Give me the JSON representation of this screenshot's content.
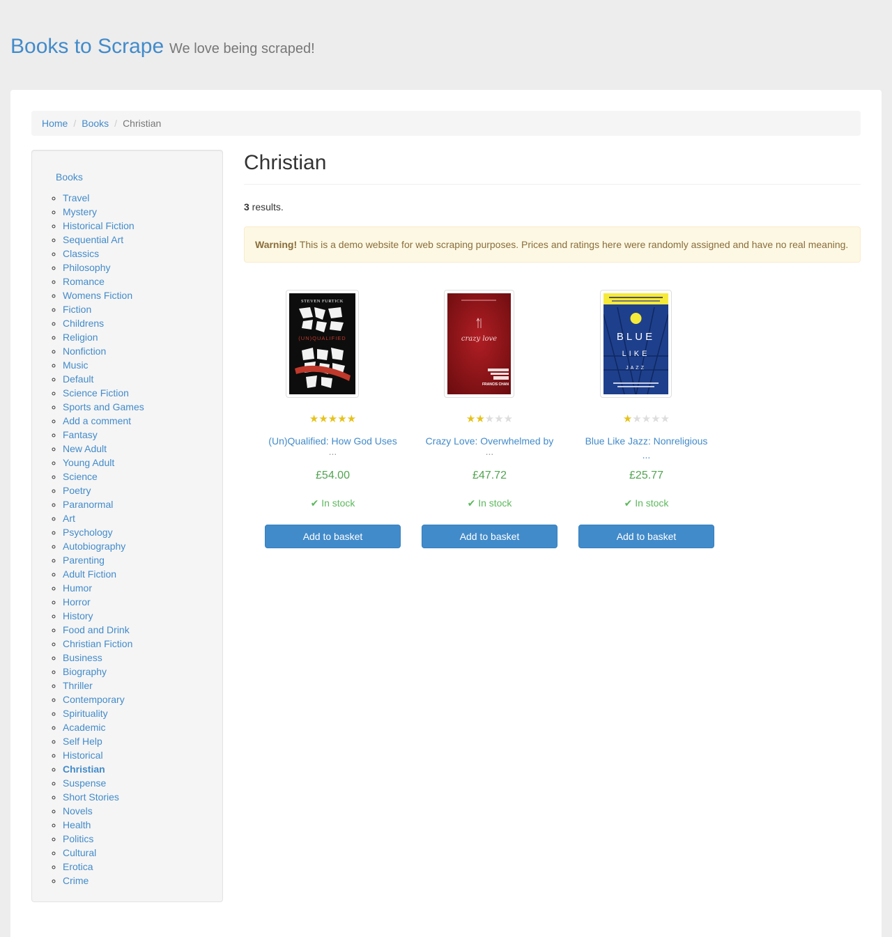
{
  "header": {
    "brand": "Books to Scrape",
    "tagline": "We love being scraped!"
  },
  "breadcrumb": {
    "items": [
      "Home",
      "Books",
      "Christian"
    ]
  },
  "sidebar": {
    "top_link": "Books",
    "categories": [
      "Travel",
      "Mystery",
      "Historical Fiction",
      "Sequential Art",
      "Classics",
      "Philosophy",
      "Romance",
      "Womens Fiction",
      "Fiction",
      "Childrens",
      "Religion",
      "Nonfiction",
      "Music",
      "Default",
      "Science Fiction",
      "Sports and Games",
      "Add a comment",
      "Fantasy",
      "New Adult",
      "Young Adult",
      "Science",
      "Poetry",
      "Paranormal",
      "Art",
      "Psychology",
      "Autobiography",
      "Parenting",
      "Adult Fiction",
      "Humor",
      "Horror",
      "History",
      "Food and Drink",
      "Christian Fiction",
      "Business",
      "Biography",
      "Thriller",
      "Contemporary",
      "Spirituality",
      "Academic",
      "Self Help",
      "Historical",
      "Christian",
      "Suspense",
      "Short Stories",
      "Novels",
      "Health",
      "Politics",
      "Cultural",
      "Erotica",
      "Crime"
    ],
    "current": "Christian"
  },
  "main": {
    "title": "Christian",
    "results_count": "3",
    "results_label": " results.",
    "alert_strong": "Warning!",
    "alert_text": " This is a demo website for web scraping purposes. Prices and ratings here were randomly assigned and have no real meaning."
  },
  "products": [
    {
      "title": "(Un)Qualified: How God Uses",
      "ellipsis": "...",
      "price": "£54.00",
      "stock": "In stock",
      "rating": 5,
      "button": "Add to basket",
      "cover": {
        "author": "STEVEN FURTICK",
        "title": "(UN)QUALIFIED"
      }
    },
    {
      "title": "Crazy Love: Overwhelmed by",
      "ellipsis": "...",
      "price": "£47.72",
      "stock": "In stock",
      "rating": 2,
      "button": "Add to basket",
      "cover": {
        "title": "crazy love",
        "author": "FRANCIS CHAN"
      }
    },
    {
      "title": "Blue Like Jazz: Nonreligious ...",
      "ellipsis": "",
      "price": "£25.77",
      "stock": "In stock",
      "rating": 1,
      "button": "Add to basket",
      "cover": {
        "line1": "BLUE",
        "line2": "LIKE",
        "line3": "JAZZ"
      }
    }
  ],
  "colors": {
    "link": "#428bca",
    "price": "#51a351",
    "stock": "#5cb85c",
    "star_on": "#e6c21a",
    "star_off": "#dddddd",
    "alert_bg": "#fcf8e3"
  }
}
